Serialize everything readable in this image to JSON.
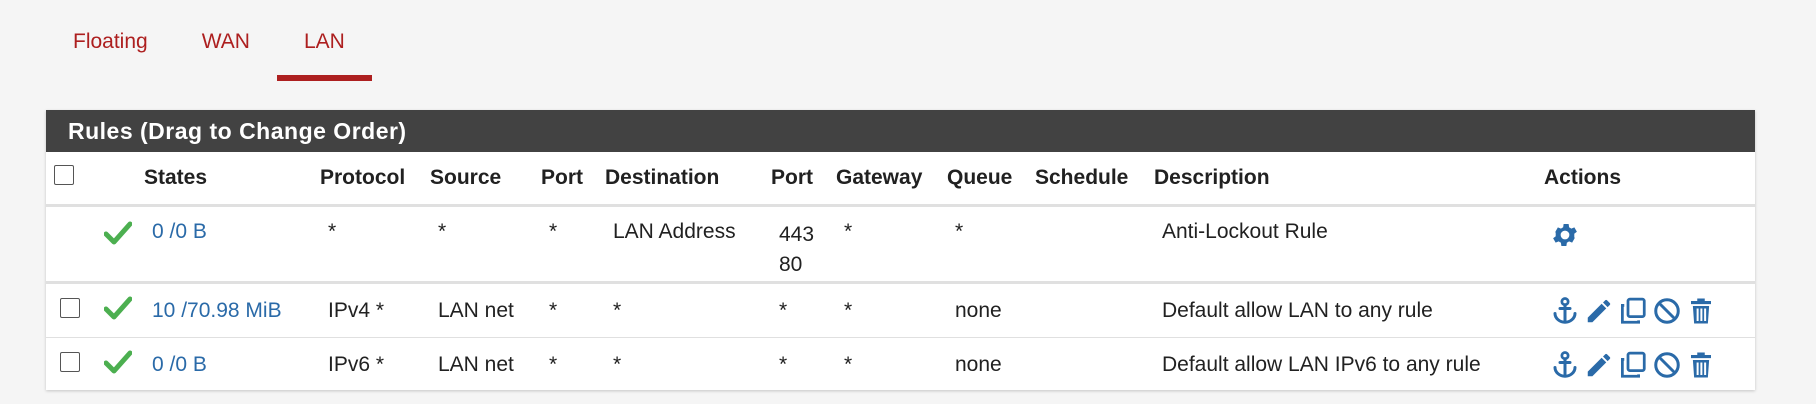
{
  "tabs": [
    {
      "label": "Floating",
      "active": false
    },
    {
      "label": "WAN",
      "active": false
    },
    {
      "label": "LAN",
      "active": true
    }
  ],
  "panel": {
    "title": "Rules (Drag to Change Order)"
  },
  "columns": [
    "States",
    "Protocol",
    "Source",
    "Port",
    "Destination",
    "Port",
    "Gateway",
    "Queue",
    "Schedule",
    "Description",
    "Actions"
  ],
  "rows": [
    {
      "has_checkbox": false,
      "status_icon": "check-icon",
      "states": "0 /0 B",
      "protocol": "*",
      "source": "*",
      "source_port": "*",
      "destination": "LAN Address",
      "dest_port_1": "443",
      "dest_port_2": "80",
      "gateway": "*",
      "queue": "*",
      "schedule": "",
      "description": "Anti-Lockout Rule",
      "actions": [
        "gear-icon"
      ]
    },
    {
      "has_checkbox": true,
      "status_icon": "check-icon",
      "states": "10 /70.98 MiB",
      "protocol": "IPv4 *",
      "source": "LAN net",
      "source_port": "*",
      "destination": "*",
      "dest_port": "*",
      "gateway": "*",
      "queue": "none",
      "schedule": "",
      "description": "Default allow LAN to any rule",
      "actions": [
        "anchor-icon",
        "pencil-icon",
        "copy-icon",
        "disable-icon",
        "trash-icon"
      ]
    },
    {
      "has_checkbox": true,
      "status_icon": "check-icon",
      "states": "0 /0 B",
      "protocol": "IPv6 *",
      "source": "LAN net",
      "source_port": "*",
      "destination": "*",
      "dest_port": "*",
      "gateway": "*",
      "queue": "none",
      "schedule": "",
      "description": "Default allow LAN IPv6 to any rule",
      "actions": [
        "anchor-icon",
        "pencil-icon",
        "copy-icon",
        "disable-icon",
        "trash-icon"
      ]
    }
  ],
  "colors": {
    "accent": "#ad1f1f",
    "link": "#2a6aa8",
    "check": "#4caf50",
    "icon": "#2a6aa8",
    "heading_bg": "#424242"
  }
}
